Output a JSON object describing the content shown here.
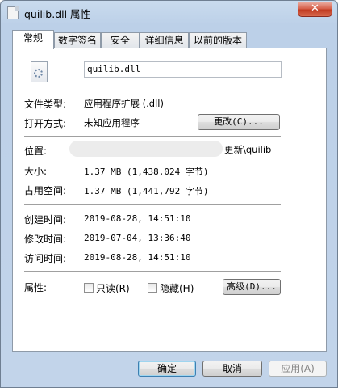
{
  "window": {
    "title": "quilib.dll 属性",
    "close_label": "✕"
  },
  "tabs": [
    {
      "label": "常规"
    },
    {
      "label": "数字签名"
    },
    {
      "label": "安全"
    },
    {
      "label": "详细信息"
    },
    {
      "label": "以前的版本"
    }
  ],
  "general": {
    "file_name": "quilib.dll",
    "file_type_label": "文件类型:",
    "file_type_value": "应用程序扩展 (.dll)",
    "opens_with_label": "打开方式:",
    "opens_with_value": "未知应用程序",
    "change_button": "更改(C)...",
    "location_label": "位置:",
    "location_value": "更新\\quilib",
    "size_label": "大小:",
    "size_value": "1.37 MB (1,438,024 字节)",
    "size_on_disk_label": "占用空间:",
    "size_on_disk_value": "1.37 MB (1,441,792 字节)",
    "created_label": "创建时间:",
    "created_value": "2019-08-28, 14:51:10",
    "modified_label": "修改时间:",
    "modified_value": "2019-07-04, 13:36:40",
    "accessed_label": "访问时间:",
    "accessed_value": "2019-08-28, 14:51:10",
    "attributes_label": "属性:",
    "readonly_label": "只读(R)",
    "hidden_label": "隐藏(H)",
    "advanced_button": "高级(D)..."
  },
  "footer": {
    "ok_button": "确定",
    "cancel_button": "取消",
    "apply_button": "应用(A)"
  }
}
